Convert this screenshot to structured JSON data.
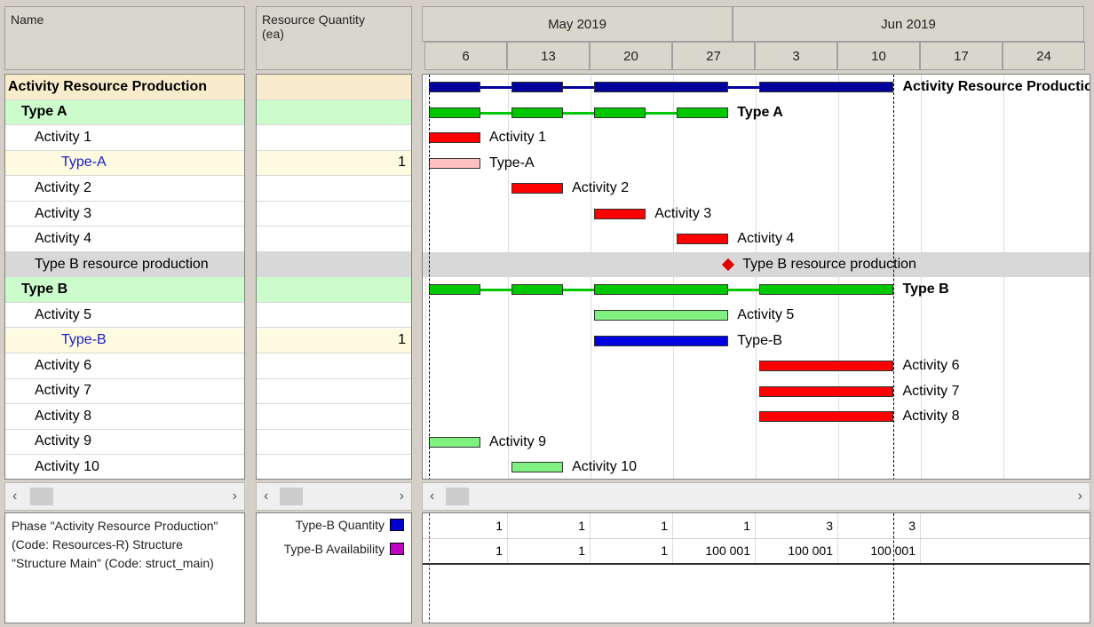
{
  "columns": {
    "name": "Name",
    "quantity": "Resource Quantity",
    "quantity_unit": "(ea)"
  },
  "timeline": {
    "months": [
      "May 2019",
      "Jun 2019"
    ],
    "weeks": [
      "6",
      "13",
      "20",
      "27",
      "3",
      "10",
      "17",
      "24"
    ]
  },
  "colors": {
    "root": "#00009c",
    "group": "#00c800",
    "activity": "#ff0000",
    "resource_a": "#ffc0c0",
    "activity_light": "#80f080",
    "resource_b": "#0000e0",
    "milestone": "#e00000",
    "root_bg": "#f8eccc",
    "group_bg": "#ccfccc",
    "resource_bg": "#fdfbe0",
    "milestone_bg": "#d8d8d8"
  },
  "rows": [
    {
      "name": "Activity Resource Production",
      "level": 0,
      "kind": "root",
      "qty": "",
      "label": "Activity Resource Production",
      "segments": [
        [
          "2019-05-06",
          "2019-05-10"
        ],
        [
          "2019-05-13",
          "2019-05-17"
        ],
        [
          "2019-05-20",
          "2019-05-31"
        ],
        [
          "2019-06-03",
          "2019-06-14"
        ]
      ]
    },
    {
      "name": "Type A",
      "level": 1,
      "kind": "group",
      "qty": "",
      "label": "Type A",
      "segments": [
        [
          "2019-05-06",
          "2019-05-10"
        ],
        [
          "2019-05-13",
          "2019-05-17"
        ],
        [
          "2019-05-20",
          "2019-05-24"
        ],
        [
          "2019-05-27",
          "2019-05-31"
        ]
      ]
    },
    {
      "name": "Activity 1",
      "level": 2,
      "kind": "activity",
      "qty": "",
      "label": "Activity 1",
      "segments": [
        [
          "2019-05-06",
          "2019-05-10"
        ]
      ]
    },
    {
      "name": "Type-A",
      "level": 3,
      "kind": "resource_a",
      "qty": "1",
      "label": "Type-A",
      "segments": [
        [
          "2019-05-06",
          "2019-05-10"
        ]
      ]
    },
    {
      "name": "Activity 2",
      "level": 2,
      "kind": "activity",
      "qty": "",
      "label": "Activity 2",
      "segments": [
        [
          "2019-05-13",
          "2019-05-17"
        ]
      ]
    },
    {
      "name": "Activity 3",
      "level": 2,
      "kind": "activity",
      "qty": "",
      "label": "Activity 3",
      "segments": [
        [
          "2019-05-20",
          "2019-05-24"
        ]
      ]
    },
    {
      "name": "Activity 4",
      "level": 2,
      "kind": "activity",
      "qty": "",
      "label": "Activity 4",
      "segments": [
        [
          "2019-05-27",
          "2019-05-31"
        ]
      ]
    },
    {
      "name": "Type B resource production",
      "level": 2,
      "kind": "milestone",
      "qty": "",
      "label": "Type B resource production",
      "milestone": "2019-05-31"
    },
    {
      "name": "Type B",
      "level": 1,
      "kind": "group",
      "qty": "",
      "label": "Type B",
      "segments": [
        [
          "2019-05-06",
          "2019-05-10"
        ],
        [
          "2019-05-13",
          "2019-05-17"
        ],
        [
          "2019-05-20",
          "2019-05-31"
        ],
        [
          "2019-06-03",
          "2019-06-14"
        ]
      ]
    },
    {
      "name": "Activity 5",
      "level": 2,
      "kind": "activity_light",
      "qty": "",
      "label": "Activity 5",
      "segments": [
        [
          "2019-05-20",
          "2019-05-31"
        ]
      ]
    },
    {
      "name": "Type-B",
      "level": 3,
      "kind": "resource_b",
      "qty": "1",
      "label": "Type-B",
      "segments": [
        [
          "2019-05-20",
          "2019-05-31"
        ]
      ]
    },
    {
      "name": "Activity 6",
      "level": 2,
      "kind": "activity",
      "qty": "",
      "label": "Activity 6",
      "segments": [
        [
          "2019-06-03",
          "2019-06-14"
        ]
      ]
    },
    {
      "name": "Activity 7",
      "level": 2,
      "kind": "activity",
      "qty": "",
      "label": "Activity 7",
      "segments": [
        [
          "2019-06-03",
          "2019-06-14"
        ]
      ]
    },
    {
      "name": "Activity 8",
      "level": 2,
      "kind": "activity",
      "qty": "",
      "label": "Activity 8",
      "segments": [
        [
          "2019-06-03",
          "2019-06-14"
        ]
      ]
    },
    {
      "name": "Activity 9",
      "level": 2,
      "kind": "activity_light",
      "qty": "",
      "label": "Activity 9",
      "segments": [
        [
          "2019-05-06",
          "2019-05-10"
        ]
      ]
    },
    {
      "name": "Activity 10",
      "level": 2,
      "kind": "activity_light",
      "qty": "",
      "label": "Activity 10",
      "segments": [
        [
          "2019-05-13",
          "2019-05-17"
        ]
      ]
    }
  ],
  "data_date": "2019-06-14",
  "info": "Phase \"Activity Resource Production\" (Code: Resources-R) Structure \"Structure Main\" (Code: struct_main)",
  "histogram": [
    {
      "label": "Type-B Quantity",
      "color": "#0000d0",
      "values": [
        "1",
        "1",
        "1",
        "1",
        "3",
        "3"
      ]
    },
    {
      "label": "Type-B Availability",
      "color": "#c000c0",
      "values": [
        "1",
        "1",
        "1",
        "100 001",
        "100 001",
        "100 001"
      ]
    }
  ],
  "scroll": {
    "left": "‹",
    "right": "›"
  }
}
